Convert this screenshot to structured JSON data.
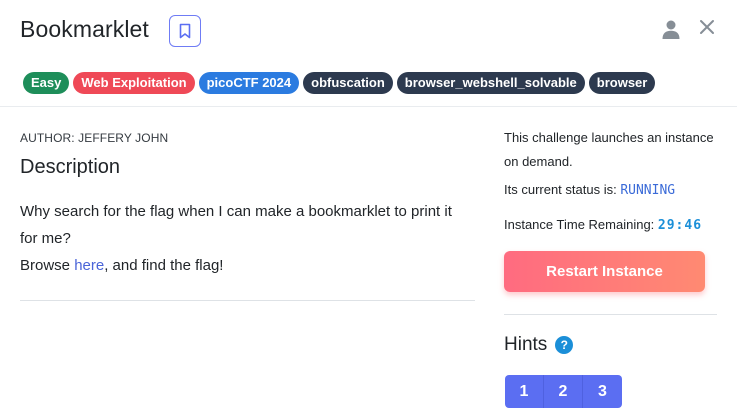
{
  "header": {
    "title": "Bookmarklet"
  },
  "tags": [
    {
      "label": "Easy",
      "color": "#1e8e5a"
    },
    {
      "label": "Web Exploitation",
      "color": "#ef4957"
    },
    {
      "label": "picoCTF 2024",
      "color": "#2b7be0"
    },
    {
      "label": "obfuscation",
      "color": "#2d3a4f"
    },
    {
      "label": "browser_webshell_solvable",
      "color": "#2d3a4f"
    },
    {
      "label": "browser",
      "color": "#2d3a4f"
    }
  ],
  "main": {
    "author": "AUTHOR: JEFFERY JOHN",
    "description_heading": "Description",
    "description_line1": "Why search for the flag when I can make a bookmarklet to print it for me?",
    "description_prefix": "Browse ",
    "description_link": "here",
    "description_suffix": ", and find the flag!"
  },
  "sidebar": {
    "launch_text": "This challenge launches an instance on demand.",
    "status_label": "Its current status is: ",
    "status_value": "RUNNING",
    "time_label": "Instance Time Remaining: ",
    "time_value": "29:46",
    "restart_label": "Restart Instance",
    "hints_heading": "Hints",
    "hints": [
      "1",
      "2",
      "3"
    ]
  }
}
